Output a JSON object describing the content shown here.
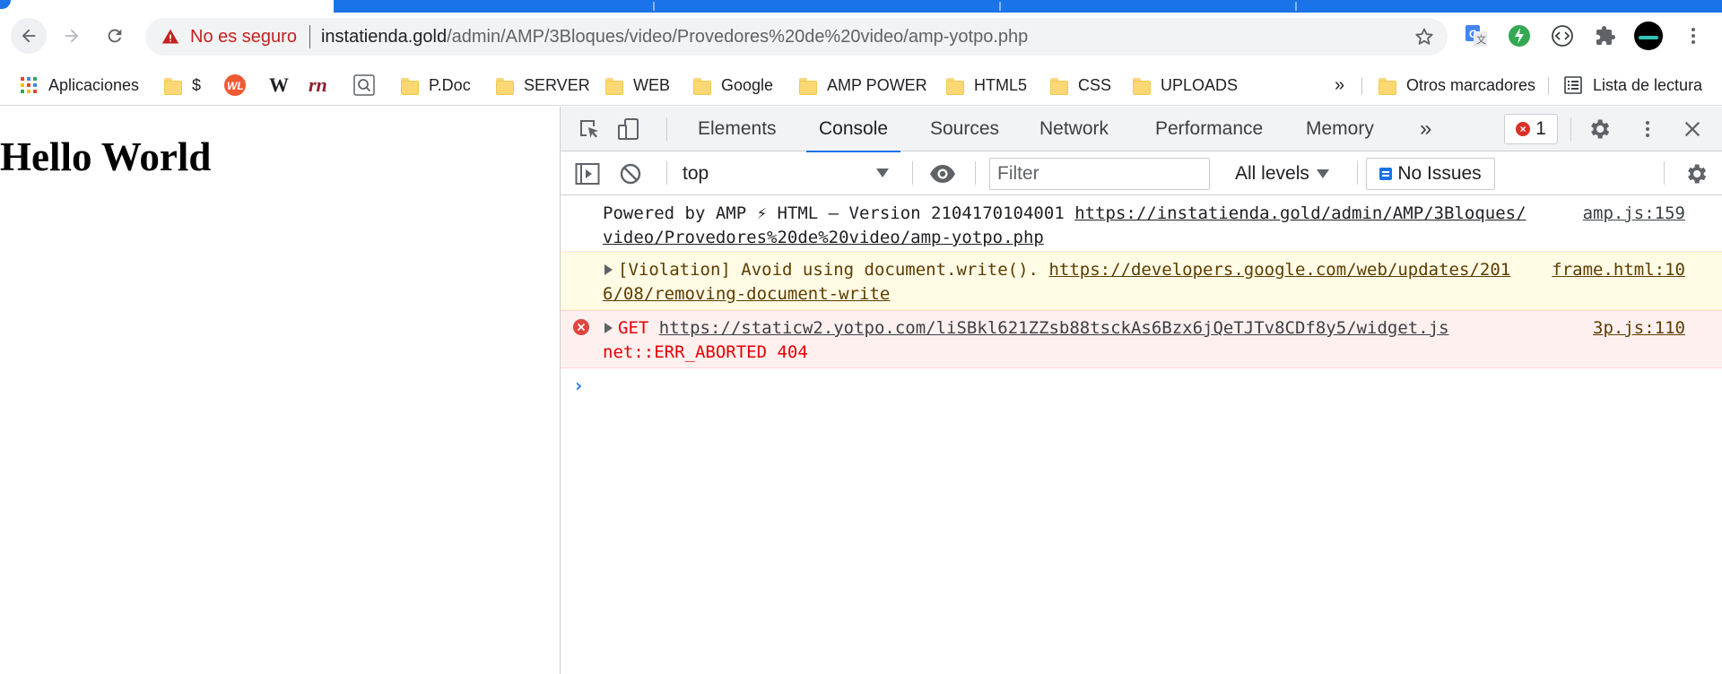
{
  "browser": {
    "security_label": "No es seguro",
    "url_host": "instatienda.gold",
    "url_path": "/admin/AMP/3Bloques/video/Provedores%20de%20video/amp-yotpo.php",
    "icons": [
      "back-arrow-icon",
      "forward-arrow-icon",
      "reload-icon",
      "warning-icon",
      "star-icon",
      "translate-icon",
      "green-extension-icon",
      "code-extension-icon",
      "puzzle-icon",
      "avatar",
      "kebab-menu-icon"
    ]
  },
  "bookmarks": {
    "apps": "Aplicaciones",
    "dollar": "$",
    "w_logo": "W",
    "rn_logo": "rn",
    "folders": [
      "P.Doc",
      "SERVER",
      "WEB",
      "Google",
      "AMP POWER",
      "HTML5",
      "CSS",
      "UPLOADS"
    ],
    "overflow": "»",
    "other": "Otros marcadores",
    "reading_list": "Lista de lectura"
  },
  "page": {
    "heading": "Hello World"
  },
  "devtools": {
    "tabs": [
      "Elements",
      "Console",
      "Sources",
      "Network",
      "Performance",
      "Memory"
    ],
    "more_tabs": "»",
    "active_tab": "Console",
    "error_count": "1",
    "context": "top",
    "filter_placeholder": "Filter",
    "levels": "All levels",
    "issues": "No Issues",
    "messages": {
      "log": {
        "text": "Powered by AMP ⚡ HTML – Version 2104170104001 ",
        "link": "https://instatienda.gold/admin/AMP/3Bloques/video/Provedores%20de%20video/amp-yotpo.php",
        "source": "amp.js:159"
      },
      "warning": {
        "text": "[Violation] Avoid using document.write(). ",
        "link": "https://developers.google.com/web/updates/2016/08/removing-document-write",
        "source": "frame.html:10"
      },
      "error": {
        "method": "GET ",
        "link": "https://staticw2.yotpo.com/liSBkl621ZZsb88tsckAs6Bzx6jQeTJTv8CDf8y5/widget.js",
        "status": "net::ERR_ABORTED 404",
        "source": "3p.js:110"
      }
    },
    "prompt": "›"
  },
  "colors": {
    "accent": "#1a73e8",
    "error": "#e50000",
    "warning_bg": "#fffbe5",
    "error_bg": "#fff0f0",
    "insecure": "#c5221f"
  }
}
